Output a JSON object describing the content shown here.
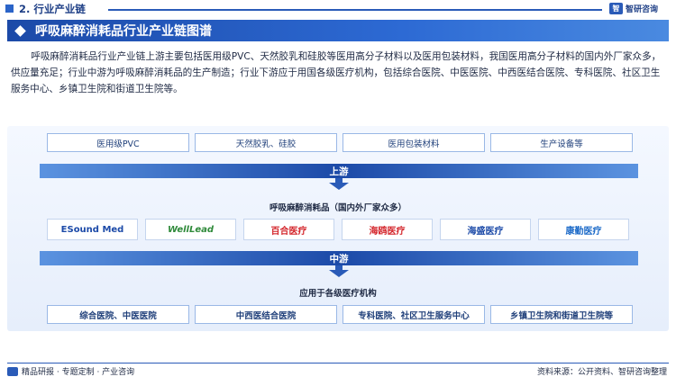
{
  "header": {
    "section_title": "2. 行业产业链",
    "brand_name": "智研咨询",
    "brand_logo_text": "智"
  },
  "title": "呼吸麻醉消耗品行业产业链图谱",
  "description": "呼吸麻醉消耗品行业产业链上游主要包括医用级PVC、天然胶乳和硅胶等医用高分子材料以及医用包装材料，我国医用高分子材料的国内外厂家众多，供应量充足；行业中游为呼吸麻醉消耗品的生产制造；行业下游应于用国各级医疗机构，包括综合医院、中医医院、中西医结合医院、专科医院、社区卫生服务中心、乡镇卫生院和街道卫生院等。",
  "upstream": {
    "items": [
      "医用级PVC",
      "天然胶乳、硅胶",
      "医用包装材料",
      "生产设备等"
    ],
    "stage_label": "上游"
  },
  "midstream": {
    "heading": "呼吸麻醉消耗品（国内外厂家众多）",
    "companies": [
      {
        "name": "ESound Med",
        "color": "#1c4aa8",
        "icon": "esound-logo"
      },
      {
        "name": "WellLead",
        "color": "#2f8a3a",
        "icon": "welllead-logo"
      },
      {
        "name": "百合医疗",
        "color": "#d4262c",
        "icon": "baihe-logo"
      },
      {
        "name": "海鸥医疗",
        "color": "#d4262c",
        "icon": "haiou-logo"
      },
      {
        "name": "海盛医疗",
        "color": "#1c4aa8",
        "icon": "haisheng-logo"
      },
      {
        "name": "康勤医疗",
        "color": "#1c6ac8",
        "icon": "kangqin-logo"
      }
    ],
    "stage_label": "中游"
  },
  "downstream": {
    "heading": "应用于各级医疗机构",
    "items": [
      "综合医院、中医医院",
      "中西医结合医院",
      "专科医院、社区卫生服务中心",
      "乡镇卫生院和街道卫生院等"
    ]
  },
  "footer": {
    "left_text": "精品研报 · 专题定制 · 产业咨询",
    "source_text": "资料来源：公开资料、智研咨询整理"
  },
  "colors": {
    "primary": "#1c4aa8",
    "accent": "#2a5bb8",
    "panel_bg": "#e6eefb"
  }
}
